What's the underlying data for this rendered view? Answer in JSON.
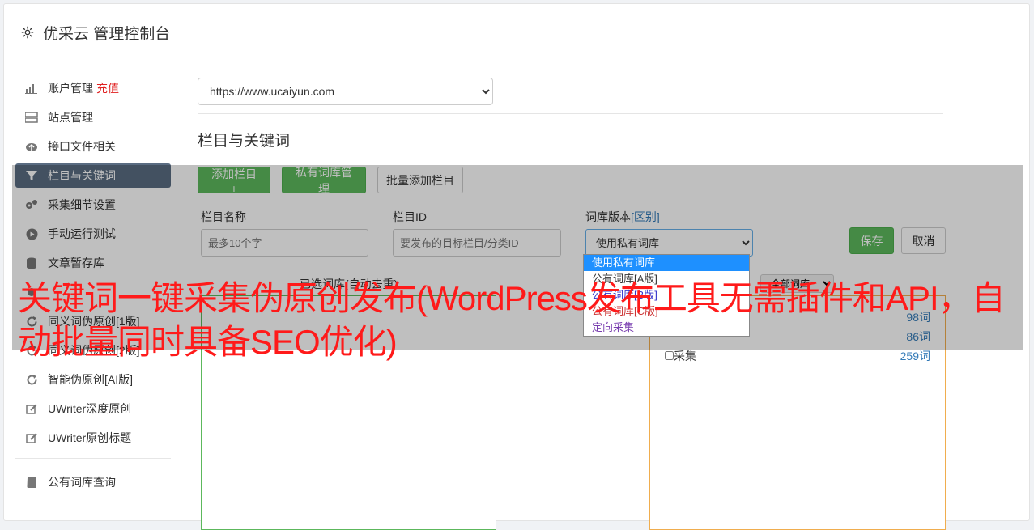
{
  "header": {
    "title": "优采云 管理控制台"
  },
  "sidebar": {
    "items": [
      {
        "label": "账户管理",
        "extra": "充值",
        "icon": "bar-chart-icon"
      },
      {
        "label": "站点管理",
        "icon": "server-icon"
      },
      {
        "label": "接口文件相关",
        "icon": "cloud-upload-icon"
      },
      {
        "label": "栏目与关键词",
        "icon": "filter-icon",
        "active": true
      },
      {
        "label": "采集细节设置",
        "icon": "gears-icon"
      },
      {
        "label": "手动运行测试",
        "icon": "play-circle-icon"
      },
      {
        "label": "文章暂存库",
        "icon": "database-icon"
      },
      {
        "label": "",
        "icon": "cog-icon"
      },
      {
        "label": "同义词伪原创[1版]",
        "icon": "refresh-icon"
      },
      {
        "label": "同义词伪原创[2版]",
        "icon": "refresh-icon"
      },
      {
        "label": "智能伪原创[AI版]",
        "icon": "refresh-icon"
      },
      {
        "label": "UWriter深度原创",
        "icon": "edit-icon"
      },
      {
        "label": "UWriter原创标题",
        "icon": "edit-icon"
      }
    ],
    "footer_item": {
      "label": "公有词库查询",
      "icon": "book-icon"
    }
  },
  "main": {
    "site_select": "https://www.ucaiyun.com",
    "section_title": "栏目与关键词",
    "toolbar": {
      "add_column": "添加栏目 +",
      "private_lib": "私有词库管理",
      "batch_add": "批量添加栏目"
    },
    "form": {
      "name_label": "栏目名称",
      "name_placeholder": "最多10个字",
      "id_label": "栏目ID",
      "id_placeholder": "要发布的目标栏目/分类ID",
      "lib_label": "词库版本",
      "lib_label_link": "[区别]",
      "lib_selected": "使用私有词库",
      "save": "保存",
      "cancel": "取消"
    },
    "lib_options": [
      "使用私有词库",
      "公有词库[A版]",
      "公有词库[B版]",
      "公有词库[C版]",
      "定向采集"
    ],
    "lib_option_colors": [
      "#ffffff",
      "#333333",
      "#3333cc",
      "#cc3333",
      "#7a3fb0"
    ],
    "selected_label": "已选词库(自动去重)",
    "filter_select": "全部词库",
    "lib_list": [
      {
        "name": "",
        "count": "98词"
      },
      {
        "name": "",
        "count": "86词"
      },
      {
        "name": "采集",
        "count": "259词"
      }
    ]
  },
  "headline": "关键词一键采集伪原创发布(WordPress发布工具无需插件和API，自动批量同时具备SEO优化)"
}
